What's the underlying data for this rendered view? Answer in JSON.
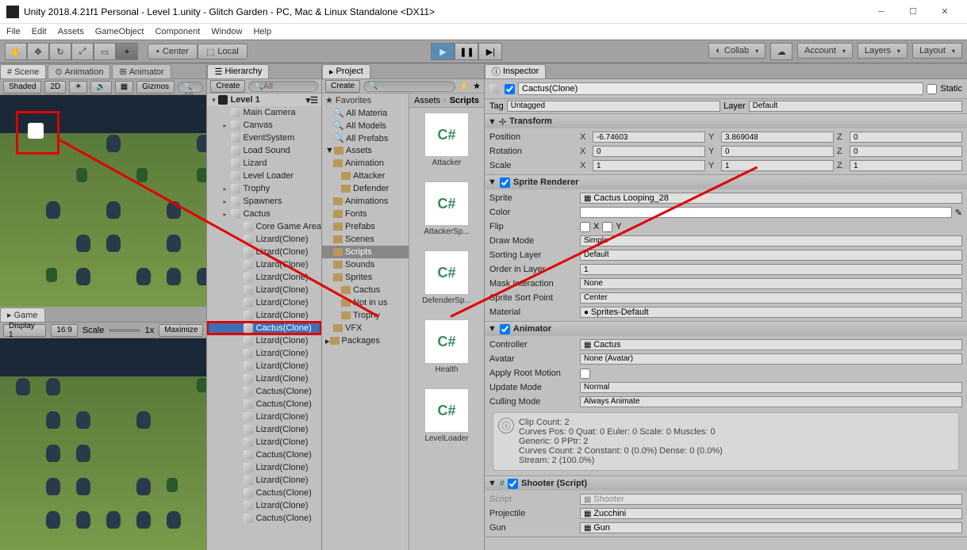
{
  "window": {
    "title": "Unity 2018.4.21f1 Personal - Level 1.unity - Glitch Garden - PC, Mac & Linux Standalone <DX11>"
  },
  "menu": [
    "File",
    "Edit",
    "Assets",
    "GameObject",
    "Component",
    "Window",
    "Help"
  ],
  "toolbar": {
    "center": "Center",
    "local": "Local",
    "collab": "Collab",
    "account": "Account",
    "layers": "Layers",
    "layout": "Layout"
  },
  "scene": {
    "tabs": [
      "Scene",
      "Animation",
      "Animator"
    ],
    "shaded": "Shaded",
    "mode": "2D",
    "gizmos": "Gizmos",
    "search": "All"
  },
  "game": {
    "tab": "Game",
    "display": "Display 1",
    "aspect": "16:9",
    "scale": "Scale",
    "scale_val": "1x",
    "maximize": "Maximize"
  },
  "hierarchy": {
    "title": "Hierarchy",
    "create": "Create",
    "search": "All",
    "root": "Level 1",
    "items": [
      {
        "name": "Main Camera",
        "depth": 1
      },
      {
        "name": "Canvas",
        "depth": 1,
        "arrow": true
      },
      {
        "name": "EventSystem",
        "depth": 1
      },
      {
        "name": "Load Sound",
        "depth": 1
      },
      {
        "name": "Lizard",
        "depth": 1
      },
      {
        "name": "Level Loader",
        "depth": 1
      },
      {
        "name": "Trophy",
        "depth": 1,
        "arrow": true
      },
      {
        "name": "Spawners",
        "depth": 1,
        "arrow": true
      },
      {
        "name": "Cactus",
        "depth": 1,
        "arrow": true
      },
      {
        "name": "Core Game Area",
        "depth": 2
      },
      {
        "name": "Lizard(Clone)",
        "depth": 2
      },
      {
        "name": "Lizard(Clone)",
        "depth": 2
      },
      {
        "name": "Lizard(Clone)",
        "depth": 2
      },
      {
        "name": "Lizard(Clone)",
        "depth": 2
      },
      {
        "name": "Lizard(Clone)",
        "depth": 2
      },
      {
        "name": "Lizard(Clone)",
        "depth": 2
      },
      {
        "name": "Lizard(Clone)",
        "depth": 2
      },
      {
        "name": "Cactus(Clone)",
        "depth": 2,
        "selected": true,
        "highlighted": true
      },
      {
        "name": "Lizard(Clone)",
        "depth": 2
      },
      {
        "name": "Lizard(Clone)",
        "depth": 2
      },
      {
        "name": "Lizard(Clone)",
        "depth": 2
      },
      {
        "name": "Lizard(Clone)",
        "depth": 2
      },
      {
        "name": "Cactus(Clone)",
        "depth": 2
      },
      {
        "name": "Cactus(Clone)",
        "depth": 2
      },
      {
        "name": "Lizard(Clone)",
        "depth": 2
      },
      {
        "name": "Lizard(Clone)",
        "depth": 2
      },
      {
        "name": "Lizard(Clone)",
        "depth": 2
      },
      {
        "name": "Cactus(Clone)",
        "depth": 2
      },
      {
        "name": "Lizard(Clone)",
        "depth": 2
      },
      {
        "name": "Lizard(Clone)",
        "depth": 2
      },
      {
        "name": "Cactus(Clone)",
        "depth": 2
      },
      {
        "name": "Lizard(Clone)",
        "depth": 2
      },
      {
        "name": "Cactus(Clone)",
        "depth": 2
      }
    ]
  },
  "project": {
    "title": "Project",
    "create": "Create",
    "favorites": "Favorites",
    "fav_items": [
      "All Materia",
      "All Models",
      "All Prefabs"
    ],
    "assets": "Assets",
    "folders": [
      "Animation",
      "Attacker",
      "Defender",
      "Animations",
      "Fonts",
      "Prefabs",
      "Scenes",
      "Scripts",
      "Sounds",
      "Sprites",
      "Cactus",
      "Not in us",
      "Trophy",
      "VFX"
    ],
    "packages": "Packages",
    "breadcrumb": [
      "Assets",
      "Scripts"
    ],
    "files": [
      "Attacker",
      "AttackerSp...",
      "DefenderSp...",
      "Health",
      "LevelLoader"
    ]
  },
  "inspector": {
    "title": "Inspector",
    "name": "Cactus(Clone)",
    "static": "Static",
    "tag_label": "Tag",
    "tag": "Untagged",
    "layer_label": "Layer",
    "layer": "Default",
    "transform": {
      "title": "Transform",
      "position": "Position",
      "pos": {
        "x": "-6.74603",
        "y": "3.869048",
        "z": "0"
      },
      "rotation": "Rotation",
      "rot": {
        "x": "0",
        "y": "0",
        "z": "0"
      },
      "scale": "Scale",
      "scl": {
        "x": "1",
        "y": "1",
        "z": "1"
      }
    },
    "sprite": {
      "title": "Sprite Renderer",
      "sprite_label": "Sprite",
      "sprite": "Cactus Looping_28",
      "color_label": "Color",
      "flip_label": "Flip",
      "flip_x": "X",
      "flip_y": "Y",
      "draw_label": "Draw Mode",
      "draw": "Simple",
      "sort_label": "Sorting Layer",
      "sort": "Default",
      "order_label": "Order in Layer",
      "order": "1",
      "mask_label": "Mask Interaction",
      "mask": "None",
      "sortpt_label": "Sprite Sort Point",
      "sortpt": "Center",
      "mat_label": "Material",
      "mat": "Sprites-Default"
    },
    "animator": {
      "title": "Animator",
      "ctrl_label": "Controller",
      "ctrl": "Cactus",
      "avatar_label": "Avatar",
      "avatar": "None (Avatar)",
      "root_label": "Apply Root Motion",
      "update_label": "Update Mode",
      "update": "Normal",
      "cull_label": "Culling Mode",
      "cull": "Always Animate",
      "info": "Clip Count: 2\nCurves Pos: 0 Quat: 0 Euler: 0 Scale: 0 Muscles: 0\nGeneric: 0 PPtr: 2\nCurves Count: 2 Constant: 0 (0.0%) Dense: 0 (0.0%)\nStream: 2 (100.0%)"
    },
    "shooter": {
      "title": "Shooter (Script)",
      "script_label": "Script",
      "script": "Shooter",
      "proj_label": "Projectile",
      "proj": "Zucchini",
      "gun_label": "Gun",
      "gun": "Gun"
    }
  }
}
